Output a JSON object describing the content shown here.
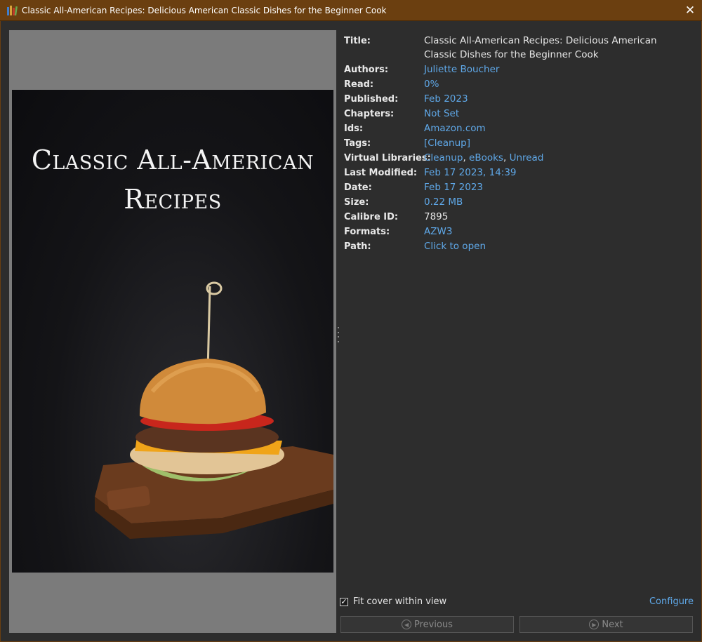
{
  "window": {
    "title": "Classic All-American Recipes: Delicious American Classic Dishes for the Beginner Cook",
    "app_icon": "calibre-books-icon",
    "close_icon": "close-icon"
  },
  "cover": {
    "title_line1": "Classic All-American",
    "title_line2": "Recipes"
  },
  "metadata": {
    "title_label": "Title:",
    "title_value": "Classic All-American Recipes: Delicious American Classic Dishes for the Beginner Cook",
    "authors_label": "Authors:",
    "authors_value": "Juliette Boucher",
    "read_label": "Read:",
    "read_value": "0%",
    "published_label": "Published:",
    "published_value": "Feb 2023",
    "chapters_label": "Chapters:",
    "chapters_value": "Not Set",
    "ids_label": "Ids:",
    "ids_value": "Amazon.com",
    "tags_label": "Tags:",
    "tags_value": "[Cleanup]",
    "virtual_libraries_label": "Virtual Libraries:",
    "virtual_libraries": [
      "Cleanup",
      "eBooks",
      "Unread"
    ],
    "virtual_libraries_separator": ", ",
    "last_modified_label": "Last Modified:",
    "last_modified_value": "Feb 17 2023, 14:39",
    "date_label": "Date:",
    "date_value": "Feb 17 2023",
    "size_label": "Size:",
    "size_value": "0.22 MB",
    "calibre_id_label": "Calibre ID:",
    "calibre_id_value": "7895",
    "formats_label": "Formats:",
    "formats_value": "AZW3",
    "path_label": "Path:",
    "path_value": "Click to open"
  },
  "bottom": {
    "fit_cover_label": "Fit cover within view",
    "fit_cover_checked": true,
    "configure_label": "Configure",
    "previous_label": "Previous",
    "next_label": "Next"
  },
  "colors": {
    "titlebar": "#6b3f10",
    "background": "#2d2d2d",
    "link": "#5fa8e8",
    "cover_pane": "#7b7b7b"
  }
}
